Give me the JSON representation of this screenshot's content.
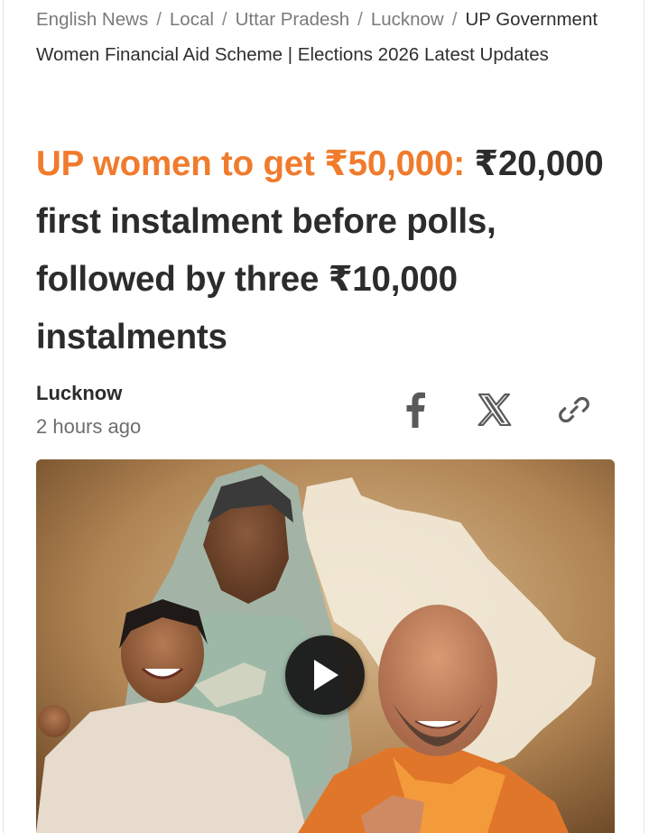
{
  "breadcrumb": {
    "items": [
      "English News",
      "Local",
      "Uttar Pradesh",
      "Lucknow"
    ],
    "current": "UP Government Women Financial Aid Scheme | Elections 2026 Latest Updates",
    "separator": "/"
  },
  "article": {
    "headline_highlight": "UP women to get ₹50,000:",
    "headline_rest": "₹20,000 first instalment before polls, followed by three ₹10,000 instalments",
    "location": "Lucknow",
    "published": "2 hours ago"
  },
  "share": {
    "icons": [
      "facebook-icon",
      "x-icon",
      "link-icon"
    ]
  },
  "media": {
    "type": "video",
    "play_icon": "play-icon"
  },
  "colors": {
    "accent": "#f07b2c",
    "text": "#2c2c2c",
    "muted": "#7a7a7a"
  }
}
